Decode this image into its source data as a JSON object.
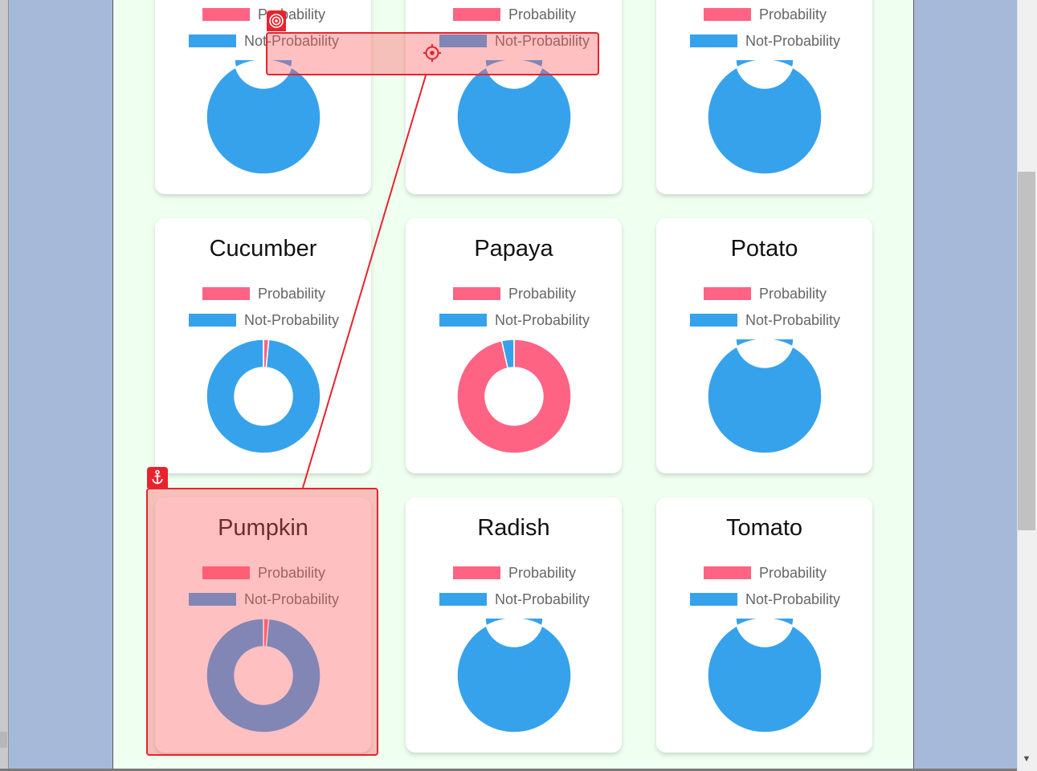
{
  "colors": {
    "probability": "#ff6384",
    "not_probability": "#36a2eb",
    "highlight": "#e8232e"
  },
  "legend": {
    "probability": "Probability",
    "not_probability": "Not-Probability"
  },
  "cards": [
    {
      "title": "",
      "chart_data": {
        "type": "pie",
        "categories": [
          "Probability",
          "Not-Probability"
        ],
        "values": [
          0,
          100
        ]
      }
    },
    {
      "title": "",
      "chart_data": {
        "type": "pie",
        "categories": [
          "Probability",
          "Not-Probability"
        ],
        "values": [
          0,
          100
        ]
      }
    },
    {
      "title": "",
      "chart_data": {
        "type": "pie",
        "categories": [
          "Probability",
          "Not-Probability"
        ],
        "values": [
          0,
          100
        ]
      }
    },
    {
      "title": "Cucumber",
      "chart_data": {
        "type": "pie",
        "categories": [
          "Probability",
          "Not-Probability"
        ],
        "values": [
          1.5,
          98.5
        ]
      }
    },
    {
      "title": "Papaya",
      "chart_data": {
        "type": "pie",
        "categories": [
          "Probability",
          "Not-Probability"
        ],
        "values": [
          96.5,
          3.5
        ]
      }
    },
    {
      "title": "Potato",
      "chart_data": {
        "type": "pie",
        "categories": [
          "Probability",
          "Not-Probability"
        ],
        "values": [
          0,
          100
        ]
      }
    },
    {
      "title": "Pumpkin",
      "chart_data": {
        "type": "pie",
        "categories": [
          "Probability",
          "Not-Probability"
        ],
        "values": [
          1.5,
          98.5
        ]
      }
    },
    {
      "title": "Radish",
      "chart_data": {
        "type": "pie",
        "categories": [
          "Probability",
          "Not-Probability"
        ],
        "values": [
          0,
          100
        ]
      }
    },
    {
      "title": "Tomato",
      "chart_data": {
        "type": "pie",
        "categories": [
          "Probability",
          "Not-Probability"
        ],
        "values": [
          0,
          100
        ]
      }
    }
  ],
  "overlay": {
    "anchor_icon": "anchor-icon",
    "target_icon": "target-icon",
    "crosshair_icon": "crosshair-icon"
  }
}
